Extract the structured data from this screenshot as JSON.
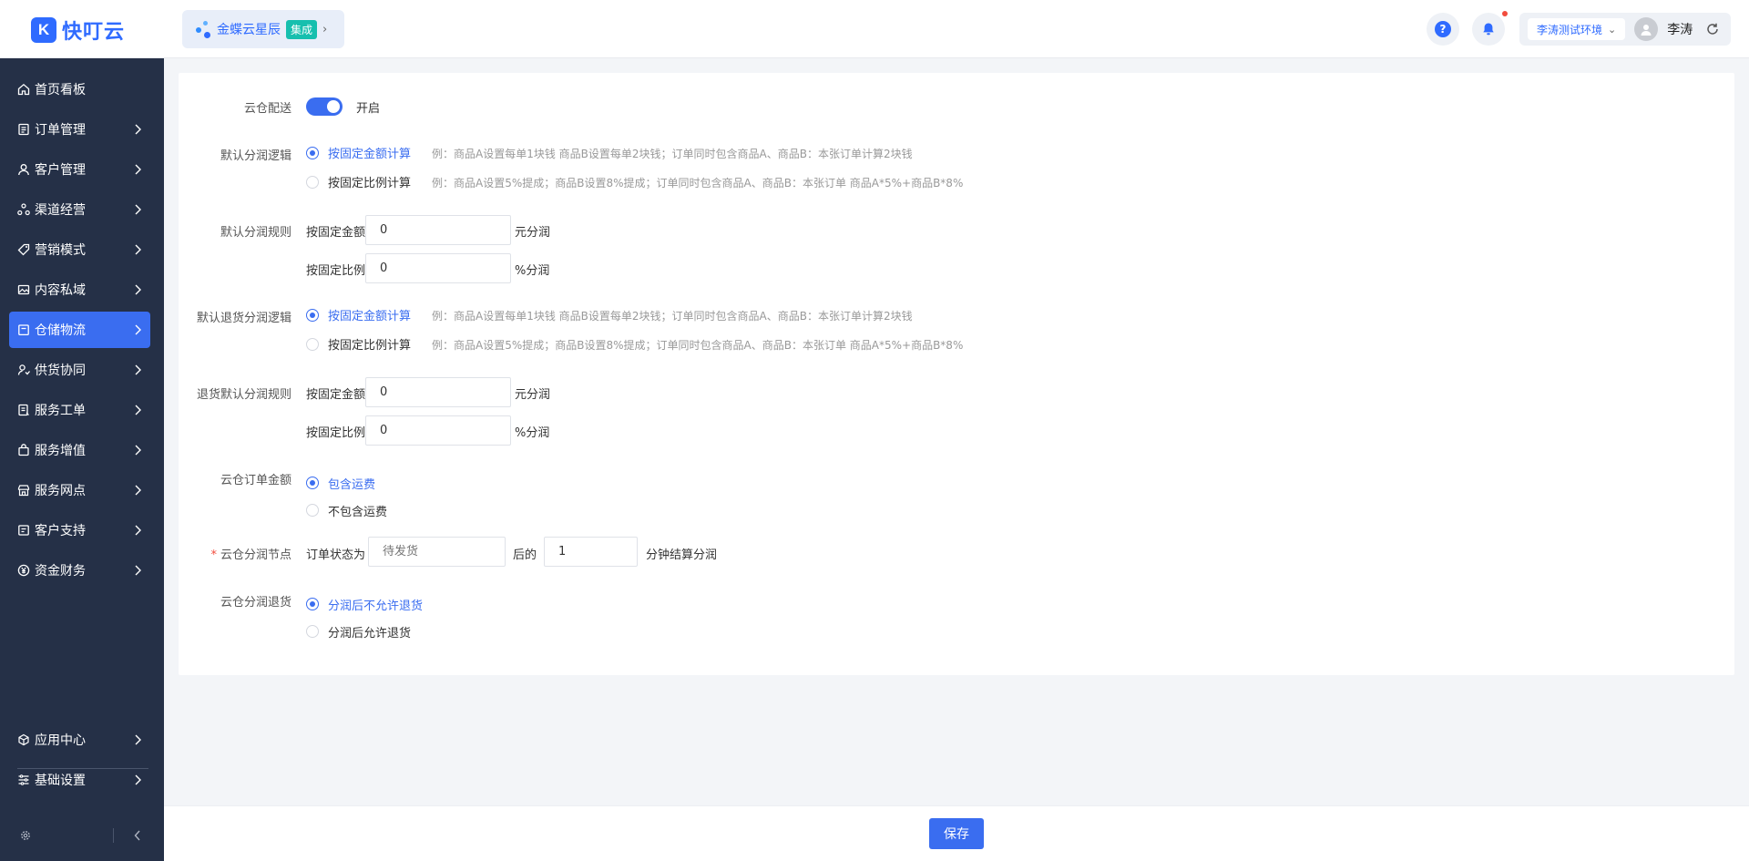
{
  "app": {
    "logo_glyph": "K",
    "logo_text": "快叮云"
  },
  "product": {
    "name": "金蝶云星辰",
    "badge": "集成"
  },
  "header": {
    "environment": "李涛测试环境",
    "user_name": "李涛"
  },
  "sidebar": {
    "items": [
      {
        "label": "首页看板",
        "icon": "home-icon"
      },
      {
        "label": "订单管理",
        "icon": "order-icon"
      },
      {
        "label": "客户管理",
        "icon": "user-icon"
      },
      {
        "label": "渠道经营",
        "icon": "channel-icon"
      },
      {
        "label": "营销模式",
        "icon": "tag-icon"
      },
      {
        "label": "内容私域",
        "icon": "image-icon"
      },
      {
        "label": "仓储物流",
        "icon": "warehouse-icon"
      },
      {
        "label": "供货协同",
        "icon": "supply-icon"
      },
      {
        "label": "服务工单",
        "icon": "ticket-icon"
      },
      {
        "label": "服务增值",
        "icon": "bag-icon"
      },
      {
        "label": "服务网点",
        "icon": "store-icon"
      },
      {
        "label": "客户支持",
        "icon": "support-icon"
      },
      {
        "label": "资金财务",
        "icon": "yen-icon"
      }
    ],
    "bottom_items": [
      {
        "label": "应用中心",
        "icon": "cube-icon"
      },
      {
        "label": "基础设置",
        "icon": "settings-list-icon"
      }
    ]
  },
  "form": {
    "cloud_delivery": {
      "label": "云仓配送",
      "toggle_text": "开启"
    },
    "default_split_logic": {
      "label": "默认分润逻辑",
      "options": [
        {
          "text": "按固定金额计算",
          "hint": "例：商品A设置每单1块钱 商品B设置每单2块钱；订单同时包含商品A、商品B：本张订单计算2块钱"
        },
        {
          "text": "按固定比例计算",
          "hint": "例：商品A设置5%提成；商品B设置8%提成；订单同时包含商品A、商品B：本张订单 商品A*5%+商品B*8%"
        }
      ]
    },
    "default_split_rule": {
      "label": "默认分润规则",
      "amount_label": "按固定金额",
      "amount_value": "0",
      "amount_unit": "元分润",
      "ratio_label": "按固定比例",
      "ratio_value": "0",
      "ratio_unit": "%分润"
    },
    "return_split_logic": {
      "label": "默认退货分润逻辑",
      "options": [
        {
          "text": "按固定金额计算",
          "hint": "例：商品A设置每单1块钱 商品B设置每单2块钱；订单同时包含商品A、商品B：本张订单计算2块钱"
        },
        {
          "text": "按固定比例计算",
          "hint": "例：商品A设置5%提成；商品B设置8%提成；订单同时包含商品A、商品B：本张订单 商品A*5%+商品B*8%"
        }
      ]
    },
    "return_split_rule": {
      "label": "退货默认分润规则",
      "amount_label": "按固定金额",
      "amount_value": "0",
      "amount_unit": "元分润",
      "ratio_label": "按固定比例",
      "ratio_value": "0",
      "ratio_unit": "%分润"
    },
    "cloud_order_amount": {
      "label": "云仓订单金额",
      "options": [
        {
          "text": "包含运费"
        },
        {
          "text": "不包含运费"
        }
      ]
    },
    "split_node": {
      "label": "云仓分润节点",
      "prefix": "订单状态为",
      "status_placeholder": "待发货",
      "middle": "后的",
      "minutes_value": "1",
      "suffix": "分钟结算分润"
    },
    "split_return": {
      "label": "云仓分润退货",
      "options": [
        {
          "text": "分润后不允许退货"
        },
        {
          "text": "分润后允许退货"
        }
      ]
    }
  },
  "footer": {
    "save_label": "保存"
  },
  "colors": {
    "primary": "#3a6df0",
    "sidebar_bg": "#253047",
    "teal_badge": "#16bfae",
    "alert": "#f24c3d"
  }
}
